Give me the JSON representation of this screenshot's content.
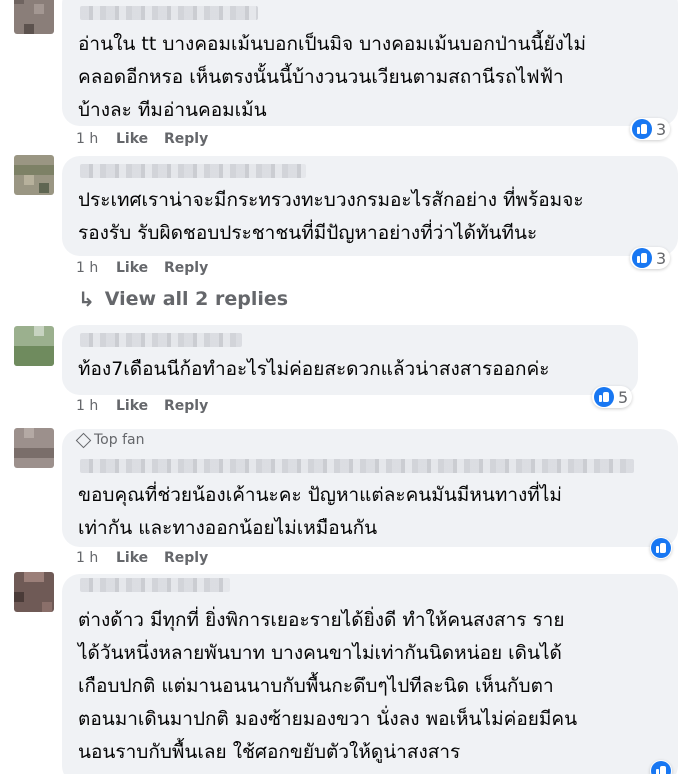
{
  "comments": [
    {
      "text_lines": [
        "อ่านใน tt บางคอมเม้นบอกเป็นมิจ บางคอมเม้นบอกป่านนี้ยังไม่",
        "คลอดอีกหรอ เห็นตรงนั้นนี้บ้างวนวนเวียนตามสถานีรถไฟฟ้า",
        "บ้างละ ทีมอ่านคอมเม้น"
      ],
      "time": "1 h",
      "like": "Like",
      "reply": "Reply",
      "reactions": "3"
    },
    {
      "text_lines": [
        "ประเทศเราน่าจะมีกระทรวงทะบวงกรมอะไรสักอย่าง ที่พร้อมจะ",
        "รองรับ รับผิดชอบประชาชนที่มีปัญหาอย่างที่ว่าได้ทันทีนะ"
      ],
      "time": "1 h",
      "like": "Like",
      "reply": "Reply",
      "reactions": "3",
      "view_replies": "View all 2 replies"
    },
    {
      "text_lines": [
        "ท้อง7เดือนนีก้อทำอะไรไม่ค่อยสะดวกแล้วน่าสงสารออกค่ะ"
      ],
      "time": "1 h",
      "like": "Like",
      "reply": "Reply",
      "reactions": "5"
    },
    {
      "badge": "Top fan",
      "text_lines": [
        "ขอบคุณที่ช่วยน้องเค้านะคะ ปัญหาแต่ละคนมันมีหนทางที่ไม่",
        "เท่ากัน และทางออกน้อยไม่เหมือนกัน"
      ],
      "time": "1 h",
      "like": "Like",
      "reply": "Reply"
    },
    {
      "text_lines": [
        "ต่างด้าว มีทุกที่ ยิ่งพิการเยอะรายได้ยิ่งดี ทำให้คนสงสาร ราย",
        "ได้วันหนึ่งหลายพันบาท บางคนขาไม่เท่ากันนิดหน่อย เดินได้",
        "เกือบปกติ แต่มานอนนาบกับพื้นกะดึบๆไปทีละนิด เห็นกับตา",
        "ตอนมาเดินมาปกติ มองซ้ายมองขวา นั่งลง พอเห็นไม่ค่อยมีคน",
        "นอนราบกับพื้นเลย ใช้ศอกขยับตัวให้ดูน่าสงสาร"
      ]
    }
  ],
  "colors": {
    "bubble": "#f0f2f5",
    "meta": "#65676b",
    "like_blue": "#1877f2"
  }
}
